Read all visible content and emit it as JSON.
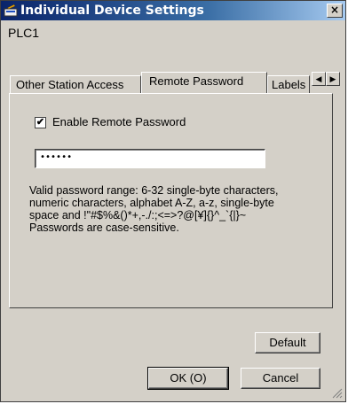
{
  "window": {
    "title": "Individual Device Settings",
    "close_glyph": "×"
  },
  "device_name": "PLC1",
  "tabs": [
    {
      "label": "Other Station Access",
      "active": false
    },
    {
      "label": "Remote Password",
      "active": true
    },
    {
      "label": "Labels",
      "active": false
    }
  ],
  "tab_scroll": {
    "left": "◀",
    "right": "▶"
  },
  "remote_password": {
    "enable_label": "Enable Remote Password",
    "enabled": true,
    "check_glyph": "✔",
    "password_value": "••••••",
    "help_lines": [
      "Valid password range: 6-32 single-byte characters,",
      "numeric characters, alphabet A-Z, a-z, single-byte",
      "space and !\"#$%&()*+,-./:;<=>?@[¥]{}^_`{|}~",
      "Passwords are case-sensitive."
    ]
  },
  "buttons": {
    "default": "Default",
    "ok": "OK (O)",
    "cancel": "Cancel"
  },
  "icons": {
    "app": "settings-app-icon",
    "close": "close-icon",
    "scroll_left": "arrow-left-icon",
    "scroll_right": "arrow-right-icon",
    "grip": "resize-grip-icon"
  },
  "colors": {
    "titlebar_start": "#0a246a",
    "titlebar_end": "#a6caf0",
    "face": "#d4d0c8"
  }
}
